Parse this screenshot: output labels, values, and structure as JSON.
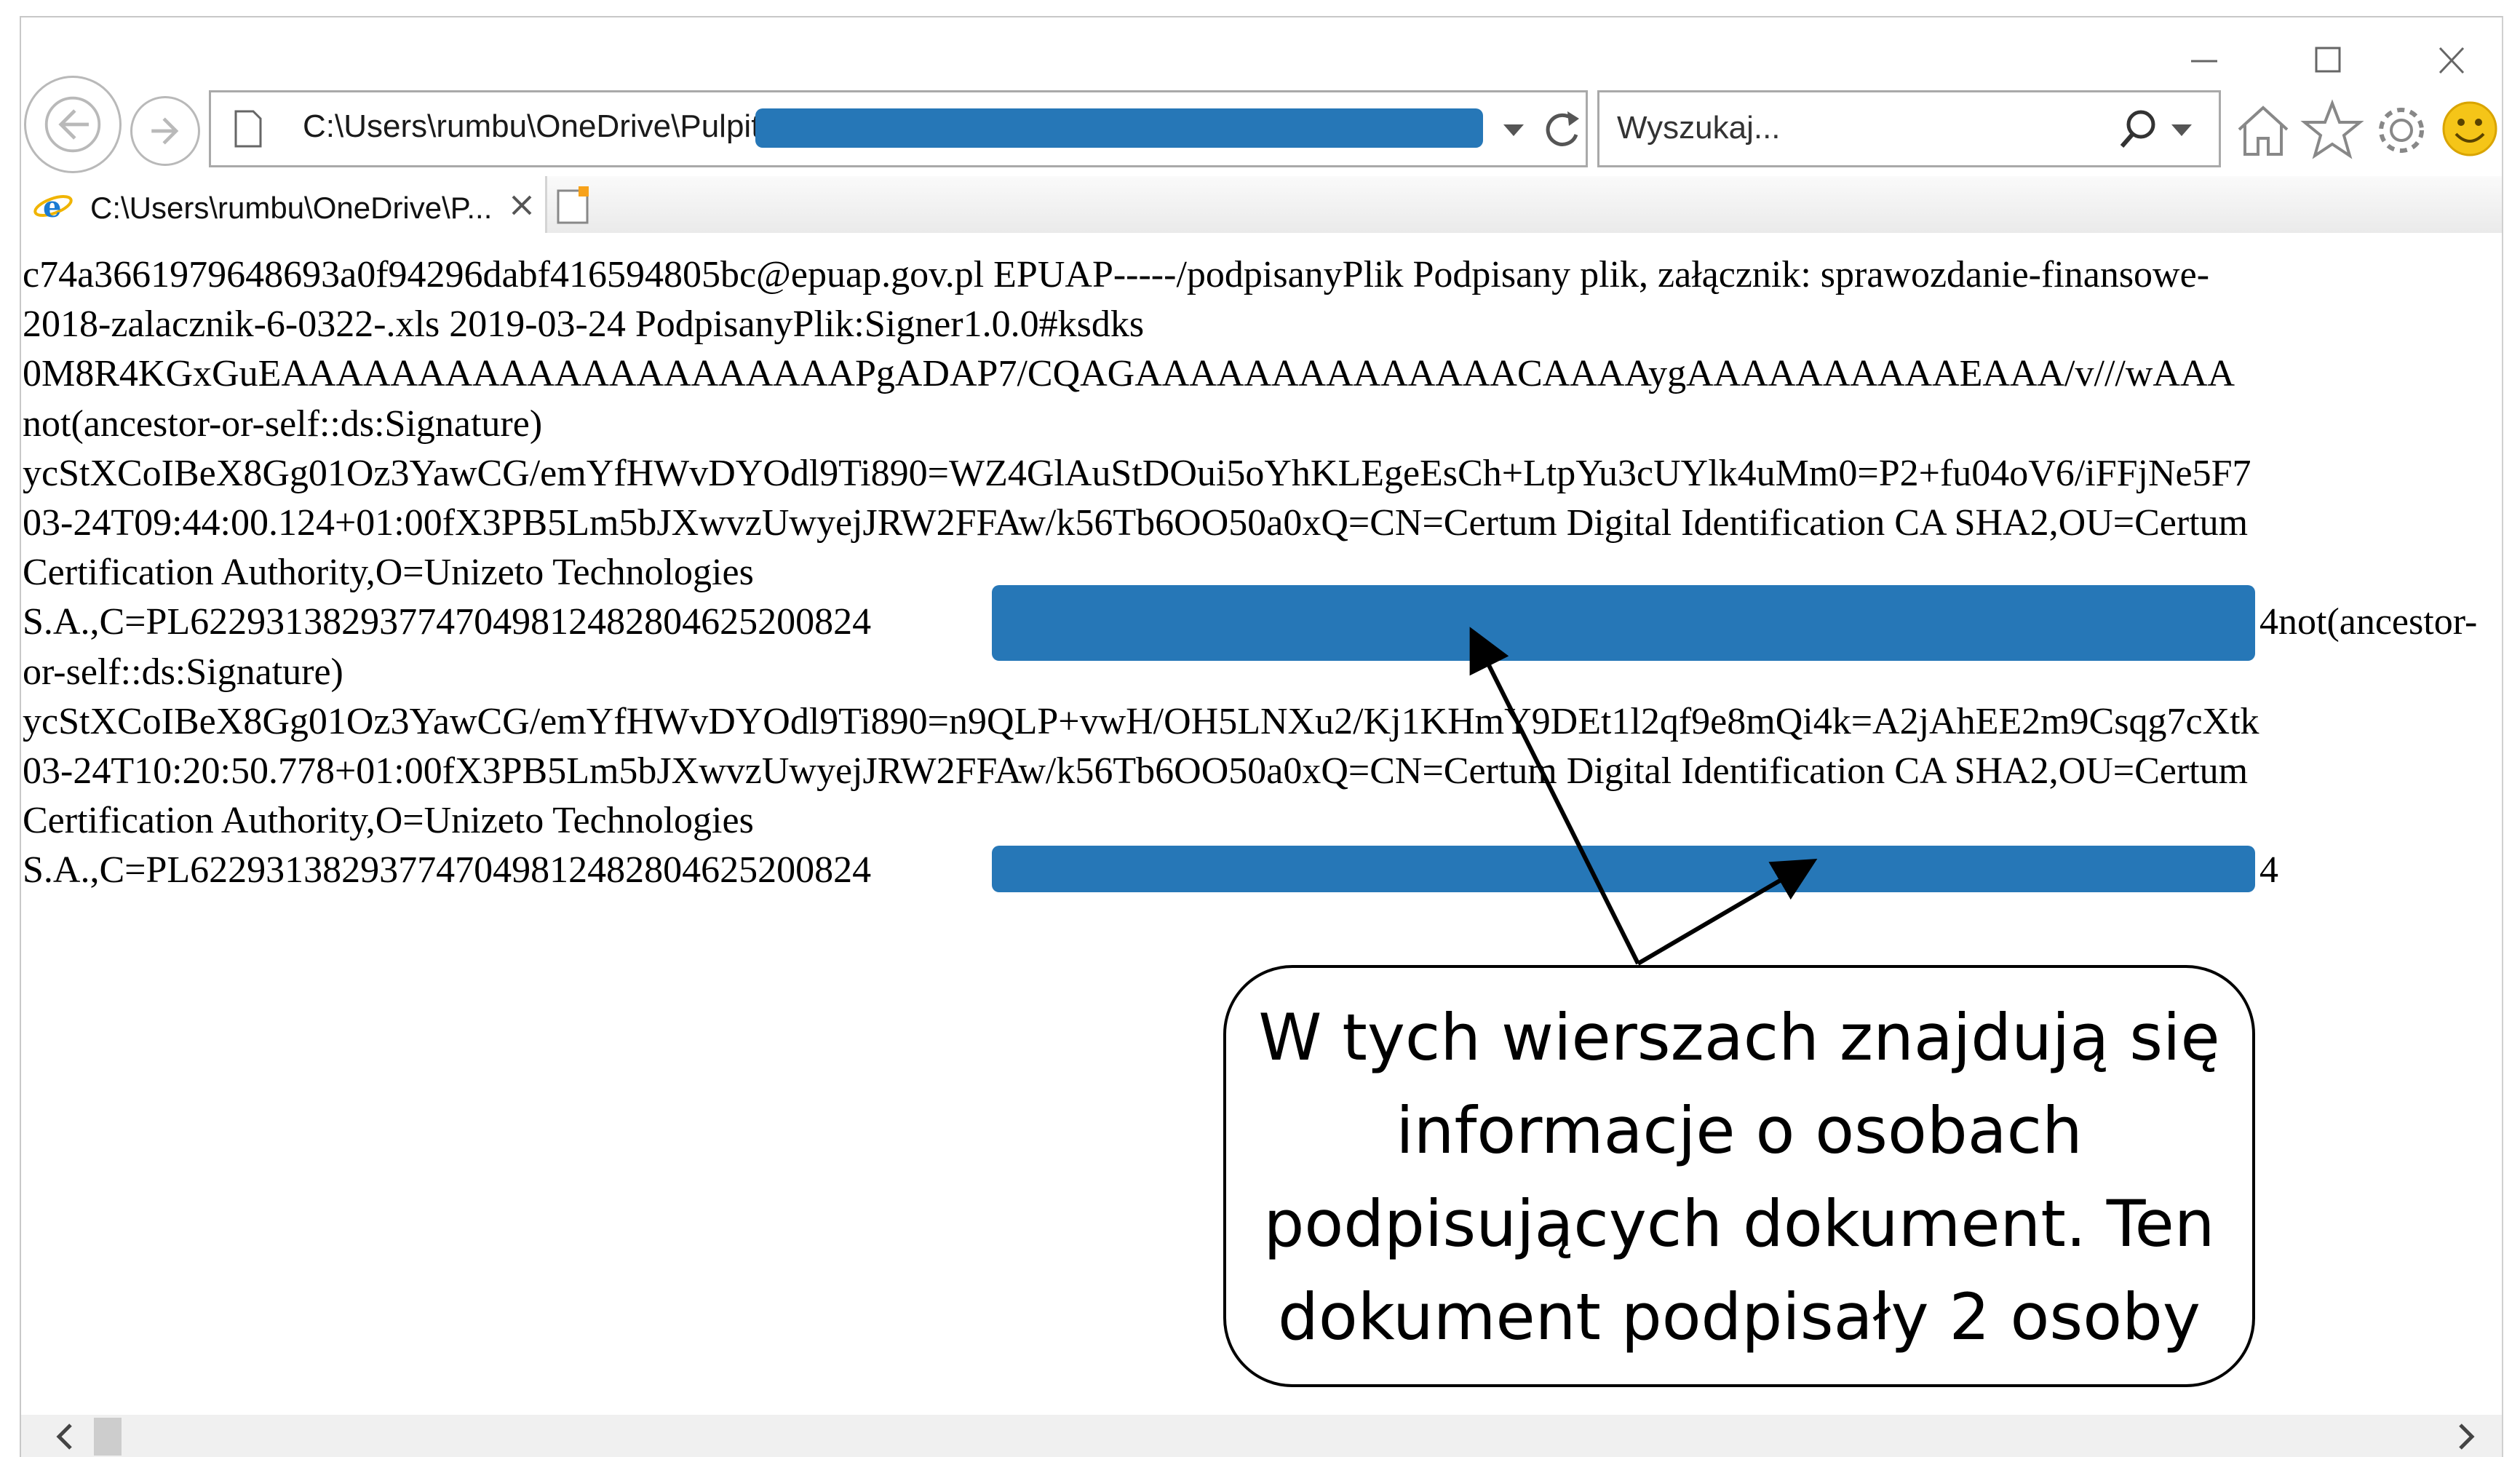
{
  "window": {
    "minimize_icon": "minimize-icon",
    "maximize_icon": "maximize-icon",
    "close_icon": "close-icon"
  },
  "toolbar": {
    "address": "C:\\Users\\rumbu\\OneDrive\\Pulpit\\",
    "search_placeholder": "Wyszukaj..."
  },
  "tab": {
    "title": "C:\\Users\\rumbu\\OneDrive\\P..."
  },
  "content": {
    "lines": [
      "c74a3661979648693a0f94296dabf416594805bc@epuap.gov.pl EPUAP-----/podpisanyPlik Podpisany plik, załącznik: sprawozdanie-finansowe-",
      "2018-zalacznik-6-0322-.xls 2019-03-24 PodpisanyPlik:Signer1.0.0#ksdks",
      "0M8R4KGxGuEAAAAAAAAAAAAAAAAAAAAAPgADAP7/CQAGAAAAAAAAAAAAAACAAAAygAAAAAAAAAAEAAA/v///wAAA",
      "not(ancestor-or-self::ds:Signature)",
      "ycStXCoIBeX8Gg01Oz3YawCG/emYfHWvDYOdl9Ti890=WZ4GlAuStDOui5oYhKLEgeEsCh+LtpYu3cUYlk4uMm0=P2+fu04oV6/iFFjNe5F7",
      "03-24T09:44:00.124+01:00fX3PB5Lm5bJXwvzUwyejJRW2FFAw/k56Tb6OO50a0xQ=CN=Certum Digital Identification CA SHA2,OU=Certum",
      "Certification Authority,O=Unizeto Technologies",
      "S.A.,C=PL622931382937747049812482804625200824",
      "or-self::ds:Signature)",
      "ycStXCoIBeX8Gg01Oz3YawCG/emYfHWvDYOdl9Ti890=n9QLP+vwH/OH5LNXu2/Kj1KHmY9DEt1l2qf9e8mQi4k=A2jAhEE2m9Csqg7cXtk",
      "03-24T10:20:50.778+01:00fX3PB5Lm5bJXwvzUwyejJRW2FFAw/k56Tb6OO50a0xQ=CN=Certum Digital Identification CA SHA2,OU=Certum",
      "Certification Authority,O=Unizeto Technologies",
      "S.A.,C=PL622931382937747049812482804625200824"
    ],
    "tail_1": "4not(ancestor-",
    "tail_2": "4",
    "redaction_color": "#2677b7"
  },
  "callout": {
    "lines": [
      "W tych wierszach znajdują się",
      "informacje o osobach",
      "podpisujących dokument. Ten",
      "dokument podpisały 2 osoby"
    ]
  }
}
